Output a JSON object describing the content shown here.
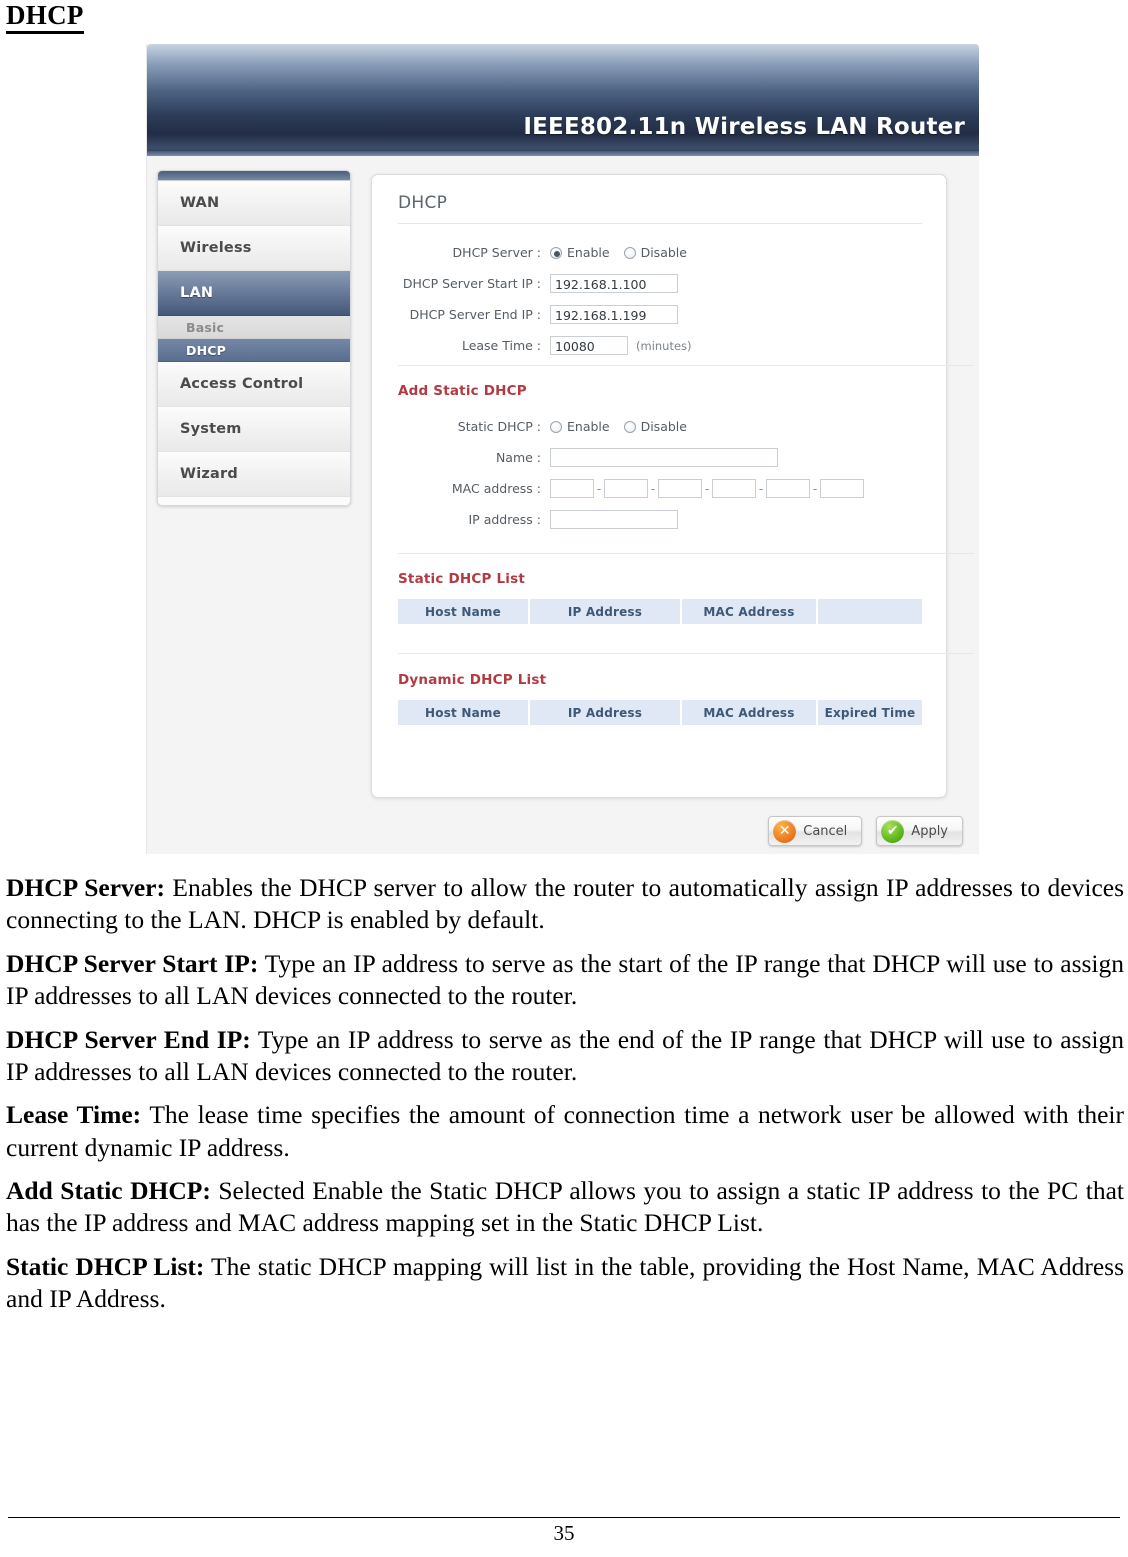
{
  "document": {
    "title": "DHCP",
    "page_number": "35"
  },
  "router_ui": {
    "brand": "IEEE802.11n  Wireless LAN Router",
    "sidebar": {
      "items": [
        {
          "label": "WAN",
          "active": false
        },
        {
          "label": "Wireless",
          "active": false
        },
        {
          "label": "LAN",
          "active": true
        },
        {
          "label": "Access Control",
          "active": false
        },
        {
          "label": "System",
          "active": false
        },
        {
          "label": "Wizard",
          "active": false
        }
      ],
      "sub_items": [
        {
          "label": "Basic",
          "active": false
        },
        {
          "label": "DHCP",
          "active": true
        }
      ]
    },
    "card": {
      "title": "DHCP",
      "dhcp": {
        "server_label": "DHCP Server :",
        "server_enable": "Enable",
        "server_disable": "Disable",
        "server_selected": "Enable",
        "start_ip_label": "DHCP Server Start IP :",
        "start_ip_value": "192.168.1.100",
        "end_ip_label": "DHCP Server End IP :",
        "end_ip_value": "192.168.1.199",
        "lease_label": "Lease Time :",
        "lease_value": "10080",
        "lease_unit": "(minutes)"
      },
      "add_static": {
        "heading": "Add Static DHCP",
        "static_label": "Static DHCP :",
        "static_enable": "Enable",
        "static_disable": "Disable",
        "static_selected": "",
        "name_label": "Name :",
        "name_value": "",
        "mac_label": "MAC address :",
        "mac_octets": [
          "",
          "",
          "",
          "",
          "",
          ""
        ],
        "mac_separator": "-",
        "ip_label": "IP address :",
        "ip_value": ""
      },
      "static_list": {
        "heading": "Static DHCP List",
        "columns": [
          "Host Name",
          "IP Address",
          "MAC Address",
          ""
        ],
        "rows": []
      },
      "dynamic_list": {
        "heading": "Dynamic DHCP List",
        "columns": [
          "Host Name",
          "IP Address",
          "MAC Address",
          "Expired Time"
        ],
        "rows": []
      }
    },
    "buttons": {
      "cancel_label": "Cancel",
      "cancel_glyph": "✕",
      "apply_label": "Apply",
      "apply_glyph": "✔"
    },
    "colors": {
      "header_dark": "#2c3c58",
      "nav_active": "#45587a",
      "section_heading": "#b23b43",
      "table_header_bg": "#dfe8f4",
      "table_header_text": "#3e5878",
      "cancel_orange": "#e8741a",
      "apply_green": "#55b116"
    }
  },
  "descriptions": [
    {
      "term": "DHCP Server:",
      "text": " Enables the DHCP server to allow the router to automatically assign IP addresses to devices connecting to the LAN. DHCP is enabled by default."
    },
    {
      "term": "DHCP Server Start IP:",
      "text": " Type an IP address to serve as the start of the IP range that DHCP will use to assign IP addresses to all LAN devices connected to the router."
    },
    {
      "term": "DHCP Server End IP:",
      "text": " Type an IP address to serve as the end of the IP range that DHCP will use to assign IP addresses to all LAN devices connected to the router."
    },
    {
      "term": "Lease Time:",
      "text": "  The lease time specifies the amount of connection time a network user be allowed with their current dynamic IP address."
    },
    {
      "term": "Add Static DHCP:",
      "text": " Selected Enable the Static DHCP allows you to assign a static IP address to the PC that has the IP address and MAC address mapping set in the Static DHCP List."
    },
    {
      "term": "Static DHCP List:",
      "text": " The static DHCP mapping will list in the table, providing the Host Name, MAC Address and IP Address."
    }
  ]
}
